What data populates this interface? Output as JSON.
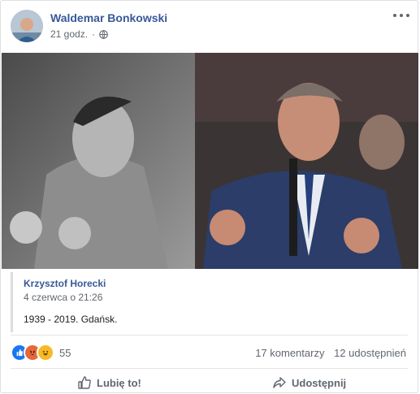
{
  "post": {
    "author": "Waldemar Bonkowski",
    "time": "21 godz.",
    "separator": "·"
  },
  "shared": {
    "author": "Krzysztof Horecki",
    "date": "4 czerwca o 21:26",
    "text": "1939 - 2019. Gdańsk."
  },
  "footer": {
    "reactions_count": "55",
    "comments": "17 komentarzy",
    "shares": "12 udostępnień"
  },
  "actions": {
    "like_label": "Lubię to!",
    "share_label": "Udostępnij"
  },
  "icons": {
    "more": "more-options-icon",
    "privacy": "globe-icon",
    "like": "thumbs-up-icon",
    "share": "share-arrow-icon",
    "reactions": [
      "like-reaction-icon",
      "angry-reaction-icon",
      "haha-reaction-icon"
    ]
  },
  "colors": {
    "link": "#385898",
    "like_reaction": "#1877f2",
    "angry_reaction": "#e4683b",
    "haha_reaction": "#f7b928"
  }
}
